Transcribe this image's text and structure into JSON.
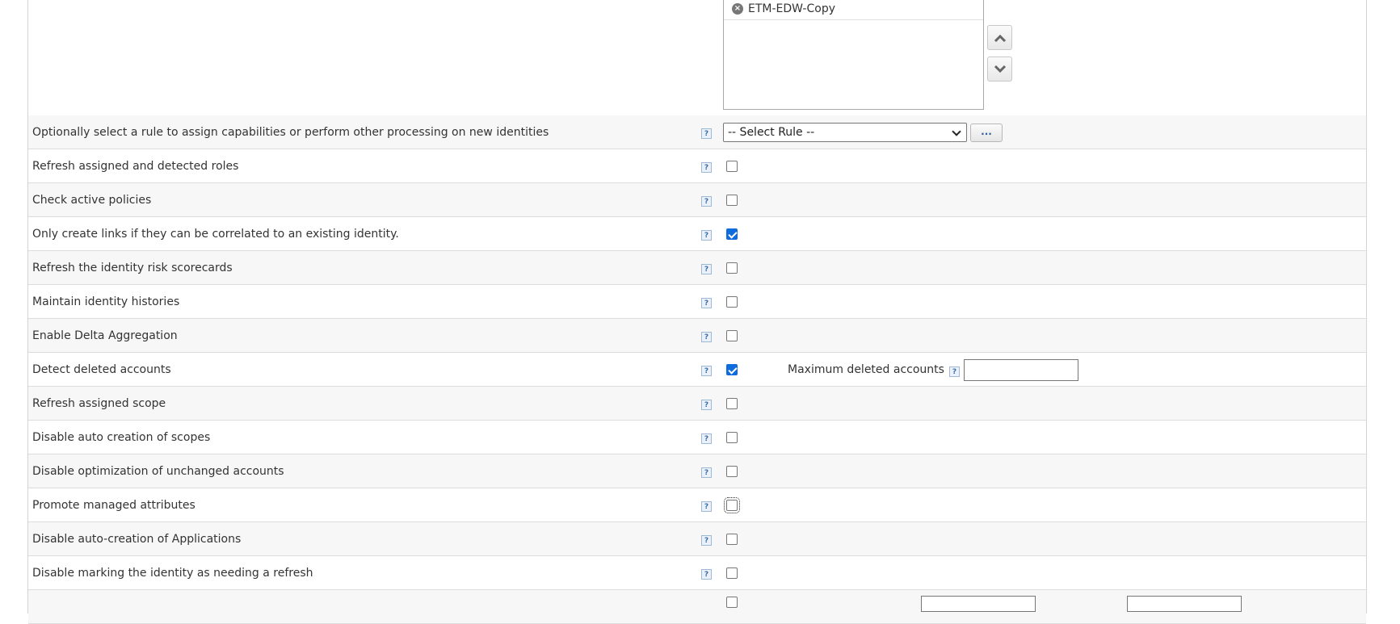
{
  "application_list": {
    "items": [
      "ETM-EDW-Copy"
    ]
  },
  "rule_select": {
    "label": "Optionally select a rule to assign capabilities or perform other processing on new identities",
    "selected": "-- Select Rule --",
    "browse_label": "..."
  },
  "help_glyph": "?",
  "options": [
    {
      "label": "Refresh assigned and detected roles",
      "checked": false
    },
    {
      "label": "Check active policies",
      "checked": false
    },
    {
      "label": "Only create links if they can be correlated to an existing identity.",
      "checked": true
    },
    {
      "label": "Refresh the identity risk scorecards",
      "checked": false
    },
    {
      "label": "Maintain identity histories",
      "checked": false
    },
    {
      "label": "Enable Delta Aggregation",
      "checked": false
    },
    {
      "label": "Detect deleted accounts",
      "checked": true
    },
    {
      "label": "Refresh assigned scope",
      "checked": false
    },
    {
      "label": "Disable auto creation of scopes",
      "checked": false
    },
    {
      "label": "Disable optimization of unchanged accounts",
      "checked": false
    },
    {
      "label": "Promote managed attributes",
      "checked": false
    },
    {
      "label": "Disable auto-creation of Applications",
      "checked": false
    },
    {
      "label": "Disable marking the identity as needing a refresh",
      "checked": false
    }
  ],
  "max_deleted": {
    "label": "Maximum deleted accounts",
    "value": ""
  }
}
